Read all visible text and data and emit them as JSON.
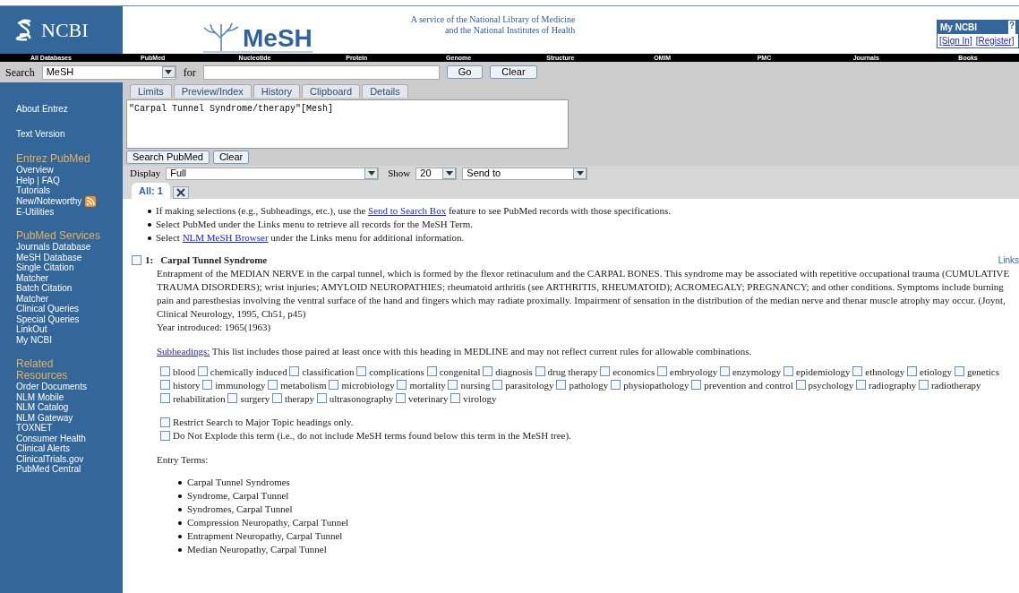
{
  "header": {
    "logo": "NCBI",
    "product": "MeSH",
    "service_lines": [
      "A service of the National Library of Medicine",
      "and the National Institutes of Health"
    ],
    "my_ncbi": {
      "title": "My NCBI",
      "help": "?",
      "links": [
        "[Sign In]",
        "[Register]"
      ]
    }
  },
  "nav": [
    "All Databases",
    "PubMed",
    "Nucleotide",
    "Protein",
    "Genome",
    "Structure",
    "OMIM",
    "PMC",
    "Journals",
    "Books"
  ],
  "search": {
    "label": "Search",
    "database": "MeSH",
    "for_label": "for",
    "buttons": [
      "Go",
      "Clear"
    ]
  },
  "tabs": [
    {
      "label": "Limits",
      "selected": false
    },
    {
      "label": "Preview/Index",
      "selected": false
    },
    {
      "label": "History",
      "selected": false
    },
    {
      "label": "Clipboard",
      "selected": false
    },
    {
      "label": "Details",
      "selected": false
    }
  ],
  "query": {
    "value": "\"Carpal Tunnel Syndrome/therapy\"[Mesh]",
    "buttons": [
      "Search PubMed",
      "Clear"
    ]
  },
  "display": {
    "label": "Display",
    "format": "Full",
    "show_label": "Show",
    "show": "20",
    "send_to": "Send to"
  },
  "result_tabs": [
    {
      "label": "All: 1",
      "selected": true
    }
  ],
  "sidebar": [
    {
      "items": [
        {
          "label": "About Entrez"
        }
      ]
    },
    {
      "items": [
        {
          "label": "Text Version"
        }
      ]
    },
    {
      "title": "Entrez PubMed",
      "items": [
        {
          "label": "Overview"
        },
        {
          "label": "Help | FAQ"
        },
        {
          "label": "Tutorials"
        },
        {
          "label": "New/Noteworthy",
          "rss": true
        },
        {
          "label": "E-Utilities"
        }
      ]
    },
    {
      "title": "PubMed Services",
      "items": [
        {
          "label": "Journals Database"
        },
        {
          "label": "MeSH Database"
        },
        {
          "label": "Single Citation Matcher"
        },
        {
          "label": "Batch Citation Matcher"
        },
        {
          "label": "Clinical Queries"
        },
        {
          "label": "Special Queries"
        },
        {
          "label": "LinkOut"
        },
        {
          "label": "My NCBI"
        }
      ]
    },
    {
      "title": "Related Resources",
      "items": [
        {
          "label": "Order Documents"
        },
        {
          "label": "NLM Mobile"
        },
        {
          "label": "NLM Catalog"
        },
        {
          "label": "NLM Gateway"
        },
        {
          "label": "TOXNET"
        },
        {
          "label": "Consumer Health"
        },
        {
          "label": "Clinical Alerts"
        },
        {
          "label": "ClinicalTrials.gov"
        },
        {
          "label": "PubMed Central"
        }
      ]
    }
  ],
  "tips": [
    {
      "before": "If making selections (e.g., Subheadings, etc.), use the ",
      "link": "Send to Search Box",
      "after": " feature to see PubMed records with those specifications."
    },
    {
      "before": "Select PubMed under the Links menu to retrieve all records for the MeSH Term."
    },
    {
      "before": "Select ",
      "link": "NLM MeSH Browser",
      "after": " under the Links menu for additional information."
    }
  ],
  "record": {
    "checked": false,
    "number": "1:",
    "title": "Carpal Tunnel Syndrome",
    "links": "Links",
    "description": "Entrapment of the MEDIAN NERVE in the carpal tunnel, which is formed by the flexor retinaculum and the CARPAL BONES. This syndrome may be associated with repetitive occupational trauma (CUMULATIVE TRAUMA DISORDERS); wrist injuries; AMYLOID NEUROPATHIES; rheumatoid arthritis (see ARTHRITIS, RHEUMATOID); ACROMEGALY; PREGNANCY; and other conditions. Symptoms include burning pain and paresthesias involving the ventral surface of the hand and fingers which may radiate proximally. Impairment of sensation in the distribution of the median nerve and thenar muscle atrophy may occur. (Joynt, Clinical Neurology, 1995, Ch51, p45)",
    "year": "Year introduced: 1965(1963)",
    "subheadings_link": "Subheadings:",
    "subheadings_note": "This list includes those paired at least once with this heading in MEDLINE and may not reflect current rules for allowable combinations.",
    "subheadings": [
      {
        "label": "blood",
        "checked": false
      },
      {
        "label": "chemically induced",
        "checked": false
      },
      {
        "label": "classification",
        "checked": false
      },
      {
        "label": "complications",
        "checked": false
      },
      {
        "label": "congenital",
        "checked": false
      },
      {
        "label": "diagnosis",
        "checked": false
      },
      {
        "label": "drug therapy",
        "checked": false
      },
      {
        "label": "economics",
        "checked": false
      },
      {
        "label": "embryology",
        "checked": false
      },
      {
        "label": "enzymology",
        "checked": false
      },
      {
        "label": "epidemiology",
        "checked": false
      },
      {
        "label": "ethnology",
        "checked": false
      },
      {
        "label": "etiology",
        "checked": false
      },
      {
        "label": "genetics",
        "checked": false
      },
      {
        "label": "history",
        "checked": false
      },
      {
        "label": "immunology",
        "checked": false
      },
      {
        "label": "metabolism",
        "checked": false
      },
      {
        "label": "microbiology",
        "checked": false
      },
      {
        "label": "mortality",
        "checked": false
      },
      {
        "label": "nursing",
        "checked": false
      },
      {
        "label": "parasitology",
        "checked": false
      },
      {
        "label": "pathology",
        "checked": false
      },
      {
        "label": "physiopathology",
        "checked": false
      },
      {
        "label": "prevention and control",
        "checked": false
      },
      {
        "label": "psychology",
        "checked": false
      },
      {
        "label": "radiography",
        "checked": false
      },
      {
        "label": "radiotherapy",
        "checked": false
      },
      {
        "label": "rehabilitation",
        "checked": false
      },
      {
        "label": "surgery",
        "checked": false
      },
      {
        "label": "therapy",
        "checked": false
      },
      {
        "label": "ultrasonography",
        "checked": false
      },
      {
        "label": "veterinary",
        "checked": false
      },
      {
        "label": "virology",
        "checked": false
      }
    ],
    "options": [
      {
        "label": "Restrict Search to Major Topic headings only.",
        "checked": false
      },
      {
        "label": "Do Not Explode this term (i.e., do not include MeSH terms found below this term in the MeSH tree).",
        "checked": false
      }
    ],
    "entry_terms_label": "Entry Terms:",
    "entry_terms": [
      "Carpal Tunnel Syndromes",
      "Syndrome, Carpal Tunnel",
      "Syndromes, Carpal Tunnel",
      "Compression Neuropathy, Carpal Tunnel",
      "Entrapment Neuropathy, Carpal Tunnel",
      "Median Neuropathy, Carpal Tunnel"
    ]
  }
}
